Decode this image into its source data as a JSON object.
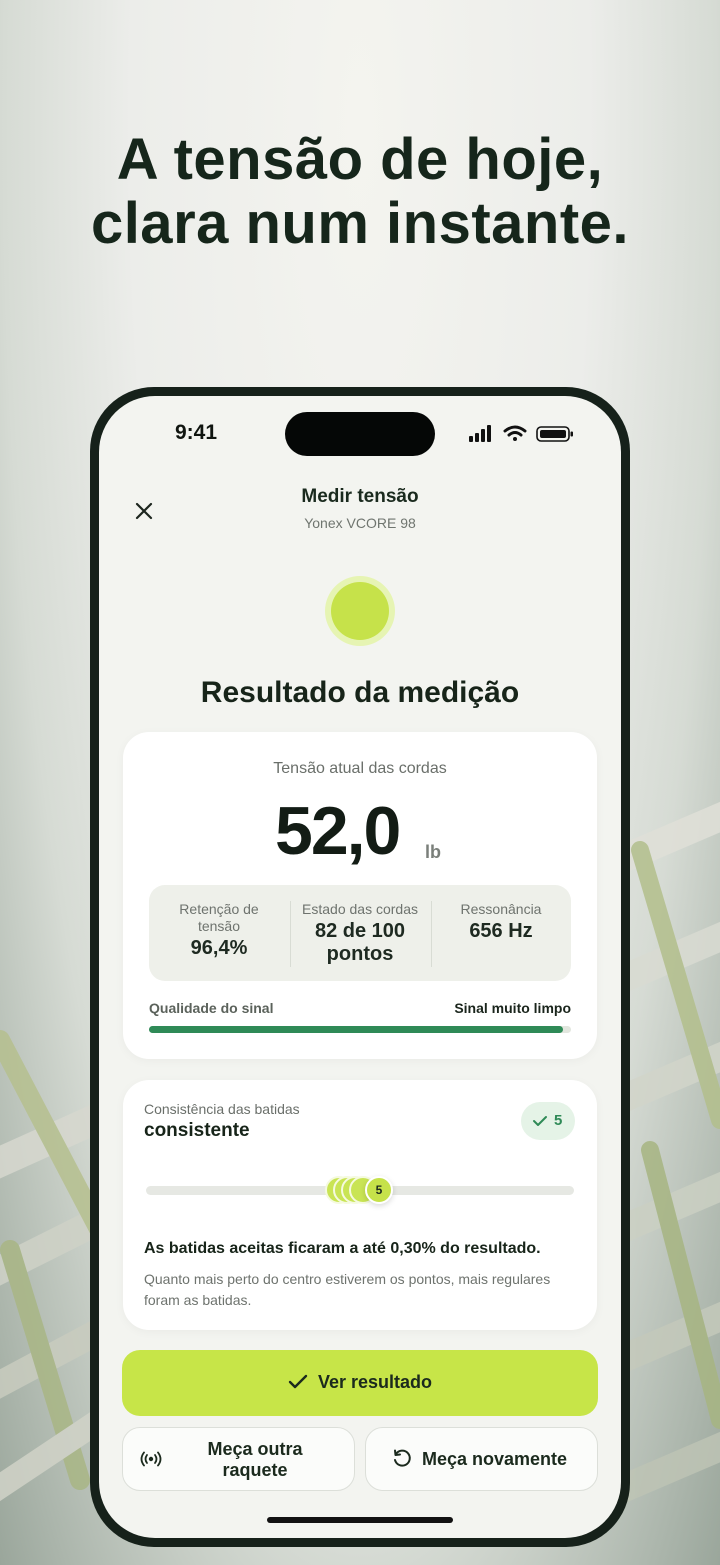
{
  "headline": {
    "line1": "A tensão de hoje,",
    "line2": "clara num instante."
  },
  "status_bar": {
    "time": "9:41"
  },
  "nav": {
    "title": "Medir tensão",
    "subtitle": "Yonex VCORE 98"
  },
  "result_title": "Resultado da medição",
  "tension_card": {
    "label": "Tensão atual das cordas",
    "value": "52,0",
    "unit": "lb",
    "stats": [
      {
        "label": "Retenção de tensão",
        "value": "96,4%"
      },
      {
        "label": "Estado das cordas",
        "value": "82 de 100 pontos"
      },
      {
        "label": "Ressonância",
        "value": "656 Hz"
      }
    ],
    "signal": {
      "label": "Qualidade do sinal",
      "value": "Sinal muito limpo",
      "level": 0.98
    }
  },
  "consistency_card": {
    "label": "Consistência das batidas",
    "value": "consistente",
    "badge_count": "5",
    "hit_count_label": "5",
    "main_text": "As batidas aceitas ficaram a até 0,30% do resultado.",
    "description": "Quanto mais perto do centro estiverem os pontos, mais regulares foram as batidas."
  },
  "buttons": {
    "primary": "Ver resultado",
    "other_racket": "Meça outra raquete",
    "measure_again": "Meça novamente"
  },
  "colors": {
    "accent": "#c7e548",
    "signal": "#2f8a57",
    "text_dark": "#172419"
  }
}
